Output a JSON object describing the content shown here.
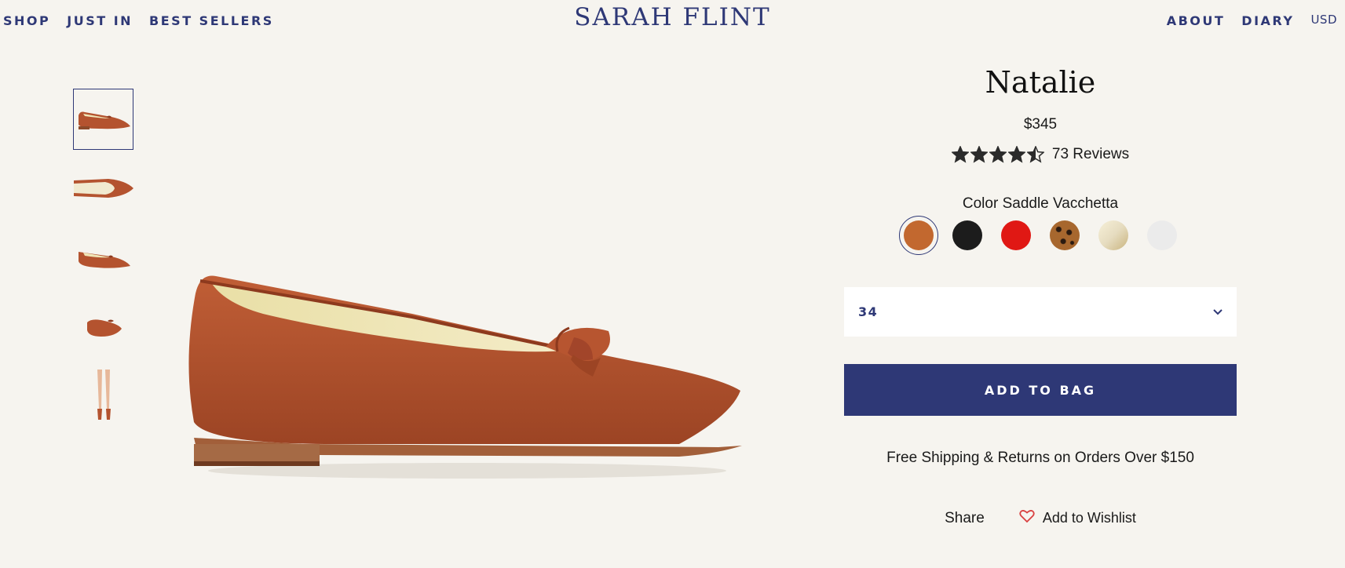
{
  "nav": {
    "left": [
      "SHOP",
      "JUST IN",
      "BEST SELLERS"
    ],
    "brand": "SARAH FLINT",
    "right": [
      "ABOUT",
      "DIARY"
    ],
    "currency": "USD"
  },
  "colors": {
    "accent": "#2e3876",
    "background": "#f6f4ef",
    "leather": "#b4532f"
  },
  "product": {
    "name": "Natalie",
    "price": "$345",
    "rating": 4.5,
    "rating_max": 5,
    "reviews": "73 Reviews",
    "color_label": "Color",
    "color_value": "Saddle Vacchetta",
    "swatches": [
      {
        "color": "#c2682f",
        "selected": true
      },
      {
        "color": "#1c1c1c",
        "selected": false
      },
      {
        "color": "#e01814",
        "selected": false
      },
      {
        "color": "#a7672e",
        "selected": false
      },
      {
        "color": "#e6dcc0",
        "selected": false
      },
      {
        "color": "#ebebeb",
        "selected": false
      }
    ],
    "size": "34",
    "add_to_bag": "ADD TO BAG",
    "shipping": "Free Shipping & Returns on Orders Over $150",
    "share": "Share",
    "wishlist": "Add to Wishlist"
  }
}
